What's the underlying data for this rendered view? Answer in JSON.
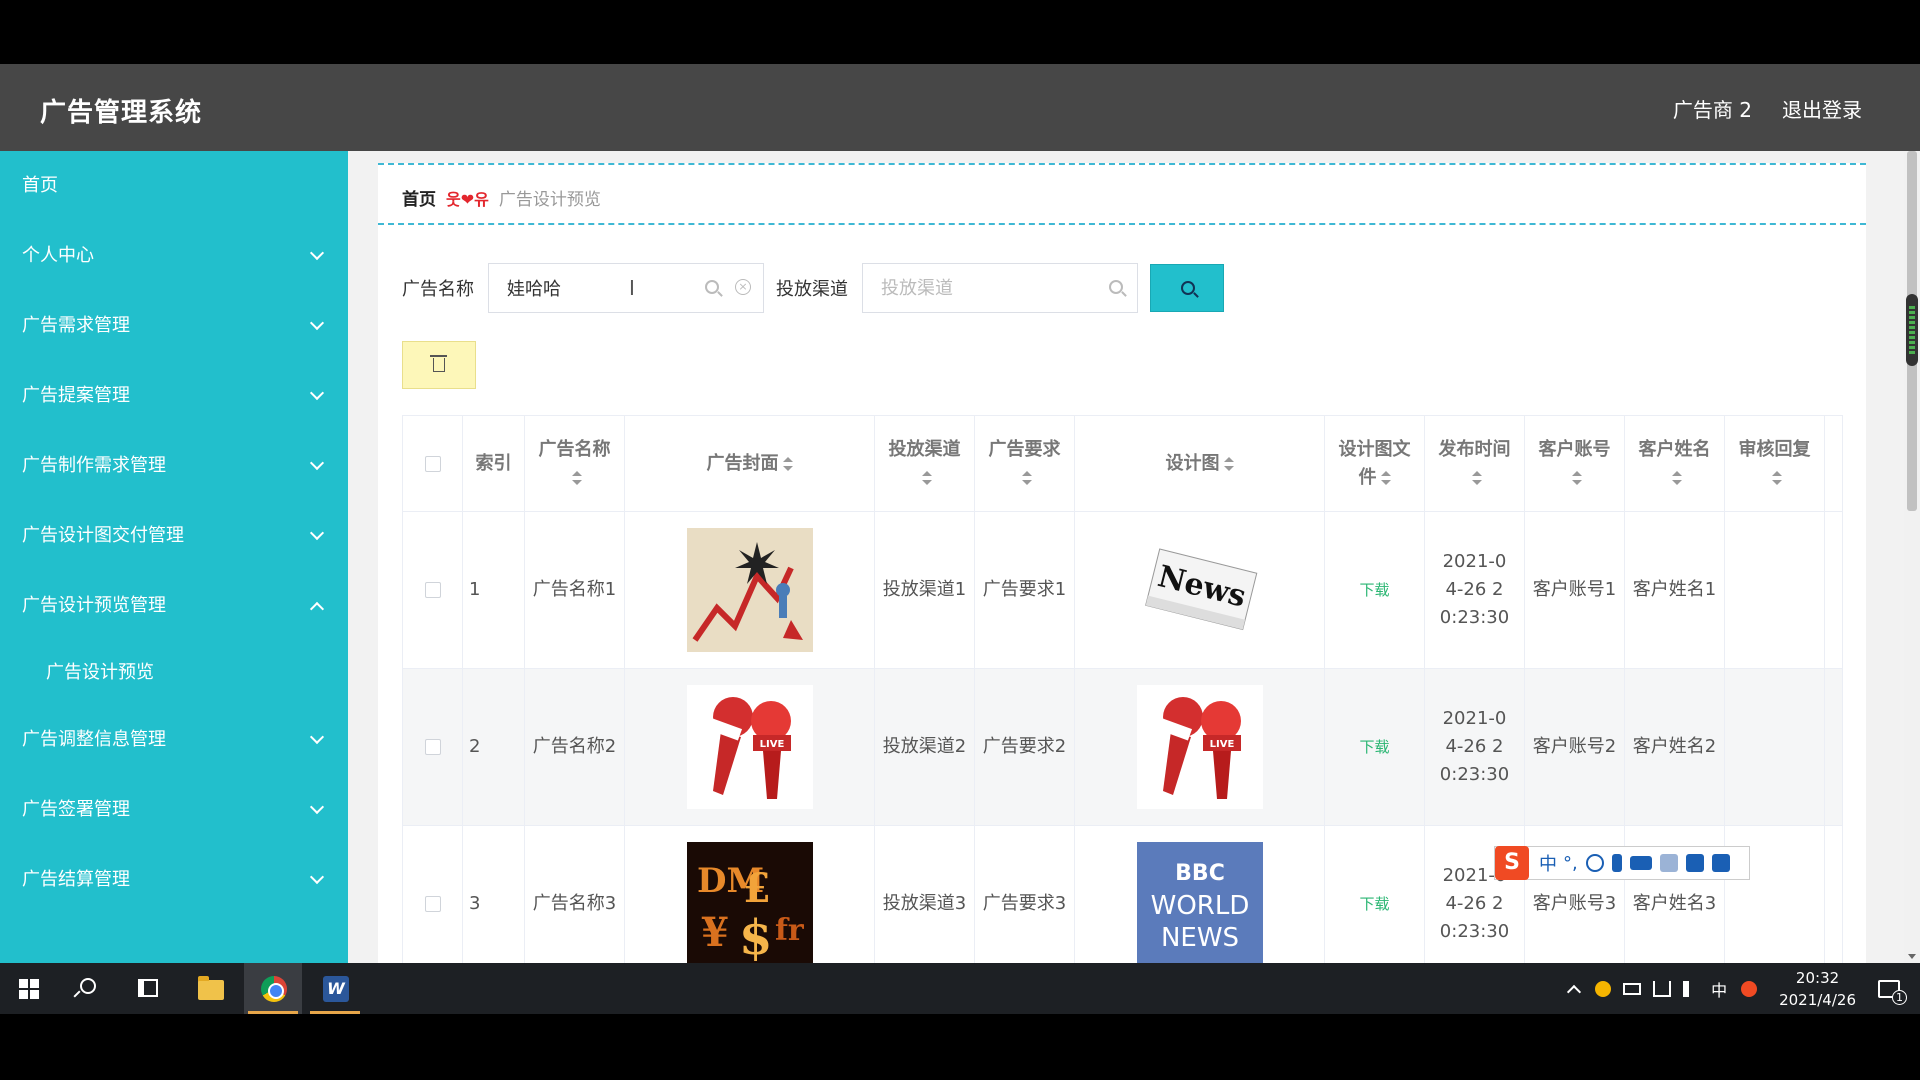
{
  "header": {
    "title": "广告管理系统",
    "user": "广告商 2",
    "logout": "退出登录"
  },
  "sidebar": {
    "items": [
      {
        "label": "首页"
      },
      {
        "label": "个人中心"
      },
      {
        "label": "广告需求管理"
      },
      {
        "label": "广告提案管理"
      },
      {
        "label": "广告制作需求管理"
      },
      {
        "label": "广告设计图交付管理"
      },
      {
        "label": "广告设计预览管理"
      },
      {
        "label": "广告设计预览"
      },
      {
        "label": "广告调整信息管理"
      },
      {
        "label": "广告签署管理"
      },
      {
        "label": "广告结算管理"
      }
    ]
  },
  "breadcrumb": {
    "home": "首页",
    "separator": "❤",
    "current": "广告设计预览"
  },
  "search": {
    "name_label": "广告名称",
    "name_value": "娃哈哈",
    "channel_label": "投放渠道",
    "channel_placeholder": "投放渠道"
  },
  "table": {
    "headers": {
      "index": "索引",
      "name": "广告名称",
      "cover": "广告封面",
      "channel": "投放渠道",
      "requirement": "广告要求",
      "design": "设计图",
      "design_file": "设计图文件",
      "publish_time": "发布时间",
      "account": "客户账号",
      "customer": "客户姓名",
      "review": "审核回复"
    },
    "rows": [
      {
        "index": "1",
        "name": "广告名称1",
        "channel": "投放渠道1",
        "requirement": "广告要求1",
        "file": "下载",
        "time": "2021-04-26 20:23:30",
        "account": "客户账号1",
        "customer": "客户姓名1",
        "cover_icon": "stock-chart-image",
        "design_icon": "news-paper-image"
      },
      {
        "index": "2",
        "name": "广告名称2",
        "channel": "投放渠道2",
        "requirement": "广告要求2",
        "file": "下载",
        "time": "2021-04-26 20:23:30",
        "account": "客户账号2",
        "customer": "客户姓名2",
        "cover_icon": "news-microphone-image",
        "design_icon": "news-microphone-image"
      },
      {
        "index": "3",
        "name": "广告名称3",
        "channel": "投放渠道3",
        "requirement": "广告要求3",
        "file": "下载",
        "time": "2021-04-26 20:23:30",
        "account": "客户账号3",
        "customer": "客户姓名3",
        "cover_icon": "currency-symbols-image",
        "design_icon": "bbc-world-news-image"
      }
    ]
  },
  "design_images": {
    "news": "News",
    "bbc_line1": "BBC",
    "bbc_line2": "WORLD",
    "bbc_line3": "NEWS",
    "live": "LIVE"
  },
  "ime": {
    "logo": "S",
    "mode": "中",
    "punct": "°,"
  },
  "taskbar": {
    "time": "20:32",
    "date": "2021/4/26",
    "lang": "中",
    "notifications": "1"
  },
  "colors": {
    "sidebar": "#22bfcc",
    "header": "#474747",
    "download": "#2bb673",
    "delete_button": "#fdf7b9"
  }
}
